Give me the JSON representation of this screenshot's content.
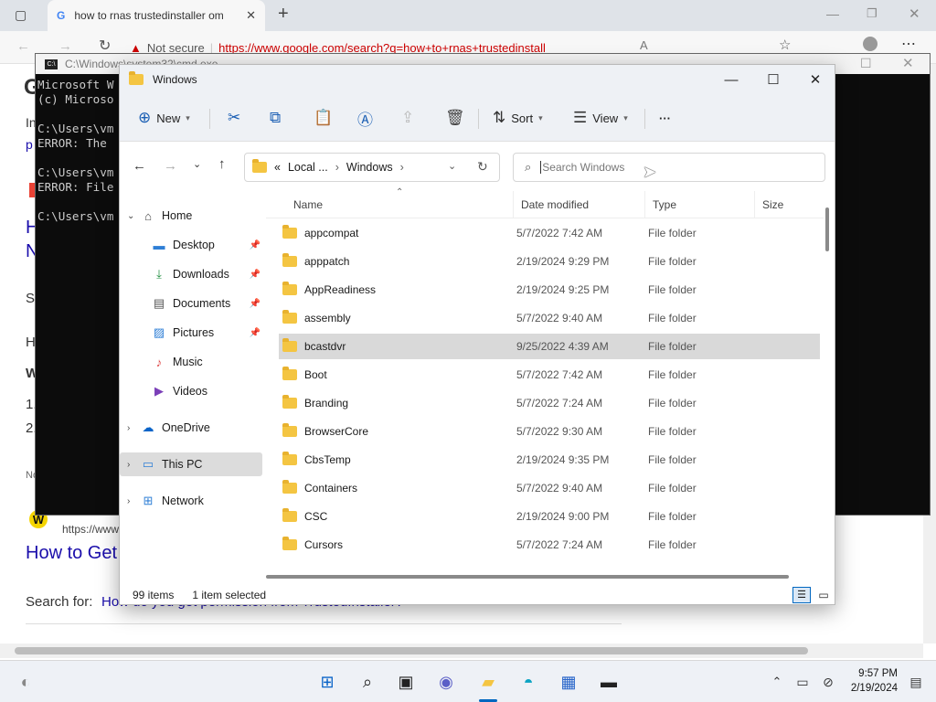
{
  "browser": {
    "tab_title": "how to rnas trustedinstaller om",
    "url_warning": "Not secure",
    "url": "https://www.google.com/search?q=how+to+rnas+trustedinstall"
  },
  "page": {
    "line_error": "ERROR: The",
    "result_title": "How to Get",
    "result_url": "https://www",
    "search_for_label": "Search for:",
    "search_for_link": "How do you get permission from TrustedInstaller?",
    "frag_in": "In",
    "frag_p": "p",
    "frag_h": "H",
    "frag_n": "N",
    "frag_s": "S",
    "frag_w": "W",
    "frag_1": "1.",
    "frag_2": "2.",
    "frag_no": "No"
  },
  "cmd": {
    "title": "C:\\Windows\\system32\\cmd.exe",
    "lines": "Microsoft W\n(c) Microso\n\nC:\\Users\\vm\nERROR: The \n\nC:\\Users\\vm\nERROR: File\n\nC:\\Users\\vm"
  },
  "explorer": {
    "title": "Windows",
    "toolbar": {
      "new": "New",
      "sort": "Sort",
      "view": "View",
      "more": "···"
    },
    "address": {
      "prefix": "«",
      "part1": "Local ...",
      "part2": "Windows"
    },
    "search_placeholder": "Search Windows",
    "nav": [
      {
        "label": "Home",
        "icon": "home-icon"
      },
      {
        "label": "Desktop",
        "icon": "desktop-icon"
      },
      {
        "label": "Downloads",
        "icon": "download-icon"
      },
      {
        "label": "Documents",
        "icon": "document-icon"
      },
      {
        "label": "Pictures",
        "icon": "picture-icon"
      },
      {
        "label": "Music",
        "icon": "music-icon"
      },
      {
        "label": "Videos",
        "icon": "video-icon"
      },
      {
        "label": "OneDrive",
        "icon": "cloud-icon"
      },
      {
        "label": "This PC",
        "icon": "computer-icon"
      },
      {
        "label": "Network",
        "icon": "network-icon"
      }
    ],
    "columns": {
      "name": "Name",
      "date": "Date modified",
      "type": "Type",
      "size": "Size"
    },
    "files": [
      {
        "name": "appcompat",
        "date": "5/7/2022 7:42 AM",
        "type": "File folder"
      },
      {
        "name": "apppatch",
        "date": "2/19/2024 9:29 PM",
        "type": "File folder"
      },
      {
        "name": "AppReadiness",
        "date": "2/19/2024 9:25 PM",
        "type": "File folder"
      },
      {
        "name": "assembly",
        "date": "5/7/2022 9:40 AM",
        "type": "File folder"
      },
      {
        "name": "bcastdvr",
        "date": "9/25/2022 4:39 AM",
        "type": "File folder"
      },
      {
        "name": "Boot",
        "date": "5/7/2022 7:42 AM",
        "type": "File folder"
      },
      {
        "name": "Branding",
        "date": "5/7/2022 7:24 AM",
        "type": "File folder"
      },
      {
        "name": "BrowserCore",
        "date": "5/7/2022 9:30 AM",
        "type": "File folder"
      },
      {
        "name": "CbsTemp",
        "date": "2/19/2024 9:35 PM",
        "type": "File folder"
      },
      {
        "name": "Containers",
        "date": "5/7/2022 9:40 AM",
        "type": "File folder"
      },
      {
        "name": "CSC",
        "date": "2/19/2024 9:00 PM",
        "type": "File folder"
      },
      {
        "name": "Cursors",
        "date": "5/7/2022 7:24 AM",
        "type": "File folder"
      }
    ],
    "status": {
      "items": "99 items",
      "selected": "1 item selected"
    }
  },
  "taskbar": {
    "time": "9:57 PM",
    "date": "2/19/2024"
  },
  "colors": {
    "accent": "#0067c0",
    "selected_row": "#d9d9d9",
    "cmd_bg": "#0c0c0c"
  }
}
